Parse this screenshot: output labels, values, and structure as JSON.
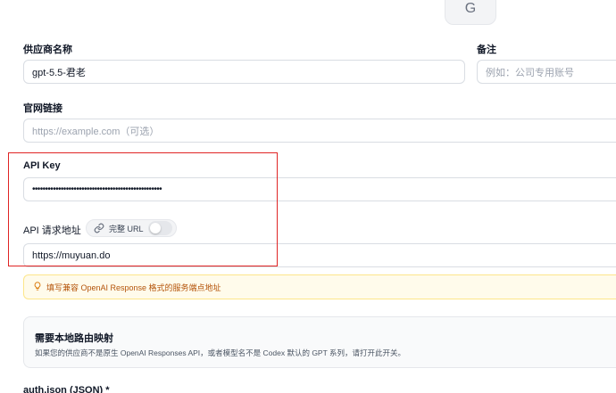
{
  "avatar": {
    "letter": "G"
  },
  "provider_name": {
    "label": "供应商名称",
    "value": "gpt-5.5-君老"
  },
  "remark": {
    "label": "备注",
    "placeholder": "例如：公司专用账号"
  },
  "website": {
    "label": "官网链接",
    "placeholder": "https://example.com（可选）"
  },
  "api_key": {
    "label": "API Key",
    "value": "••••••••••••••••••••••••••••••••••••••••••••••••••"
  },
  "api_endpoint": {
    "label": "API 请求地址",
    "full_url_toggle": {
      "label": "完整 URL",
      "on": false
    },
    "value": "https://muyuan.do"
  },
  "tip": {
    "icon": "lightbulb-icon",
    "text": "填写兼容 OpenAI Response 格式的服务端点地址"
  },
  "local_routing": {
    "title": "需要本地路由映射",
    "description": "如果您的供应商不是原生 OpenAI Responses API，或者模型名不是 Codex 默认的 GPT 系列，请打开此开关。"
  },
  "auth_json": {
    "label": "auth.json (JSON) *"
  },
  "colors": {
    "accent_red": "#e02424",
    "tip_text": "#b45309",
    "tip_bg": "#fffbeb"
  }
}
